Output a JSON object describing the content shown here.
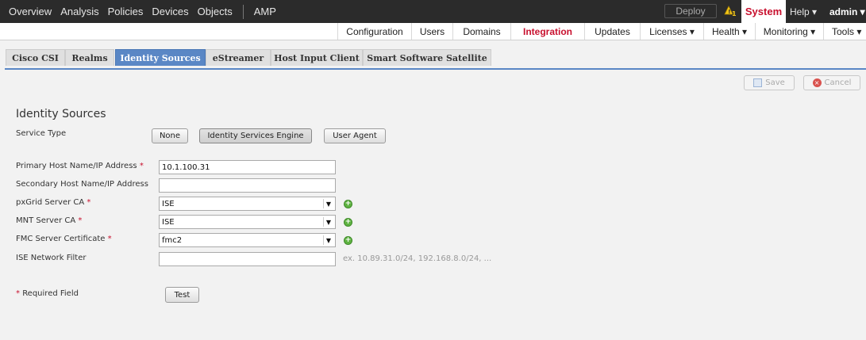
{
  "topnav": {
    "items": [
      "Overview",
      "Analysis",
      "Policies",
      "Devices",
      "Objects",
      "AMP"
    ],
    "deploy": "Deploy",
    "warning_count": "1",
    "system": "System",
    "help": "Help ▾",
    "user": "admin ▾"
  },
  "subnav": {
    "items": [
      "Configuration",
      "Users",
      "Domains",
      "Integration",
      "Updates",
      "Licenses ▾",
      "Health ▾",
      "Monitoring ▾",
      "Tools ▾"
    ],
    "active": "Integration"
  },
  "tabs": {
    "items": [
      "Cisco CSI",
      "Realms",
      "Identity Sources",
      "eStreamer",
      "Host Input Client",
      "Smart Software Satellite"
    ],
    "active": "Identity Sources"
  },
  "actions": {
    "save": "Save",
    "cancel": "Cancel"
  },
  "section_title": "Identity Sources",
  "service_type": {
    "label": "Service Type",
    "options": [
      "None",
      "Identity Services Engine",
      "User Agent"
    ],
    "selected": "Identity Services Engine"
  },
  "form": {
    "primary_host": {
      "label": "Primary Host Name/IP Address",
      "value": "10.1.100.31"
    },
    "secondary_host": {
      "label": "Secondary Host Name/IP Address",
      "value": ""
    },
    "pxgrid_ca": {
      "label": "pxGrid Server CA",
      "value": "ISE"
    },
    "mnt_ca": {
      "label": "MNT Server CA",
      "value": "ISE"
    },
    "fmc_cert": {
      "label": "FMC Server Certificate",
      "value": "fmc2"
    },
    "ise_filter": {
      "label": "ISE Network Filter",
      "value": "",
      "hint": "ex. 10.89.31.0/24, 192.168.8.0/24, ..."
    }
  },
  "required_marker": "*",
  "required_note": "Required Field",
  "test_button": "Test",
  "colors": {
    "accent": "#5a87c5",
    "brand_red": "#c8102e",
    "topbar": "#2b2b2b",
    "add_green": "#5fb342"
  }
}
